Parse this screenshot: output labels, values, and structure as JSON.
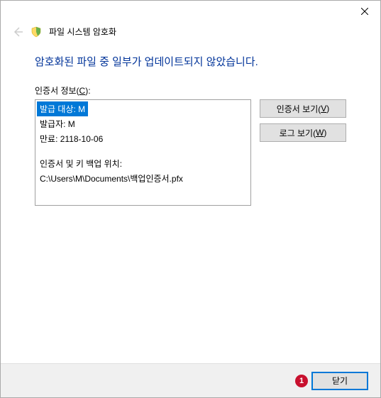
{
  "window": {
    "title": "파일 시스템 암호화"
  },
  "heading": "암호화된 파일 중 일부가 업데이트되지 않았습니다.",
  "cert": {
    "label_prefix": "인증서 정보(",
    "label_key": "C",
    "label_suffix": "):",
    "issued_to": "발급 대상: M",
    "issued_by": "발급자: M",
    "expiry": "만료: 2118-10-06",
    "backup_label": "인증서 및 키 백업 위치:",
    "backup_path": "C:\\Users\\M\\Documents\\백업인증서.pfx"
  },
  "buttons": {
    "view_cert_prefix": "인증서 보기(",
    "view_cert_key": "V",
    "view_cert_suffix": ")",
    "view_log_prefix": "로그 보기(",
    "view_log_key": "W",
    "view_log_suffix": ")",
    "close": "닫기"
  },
  "marker": "1"
}
